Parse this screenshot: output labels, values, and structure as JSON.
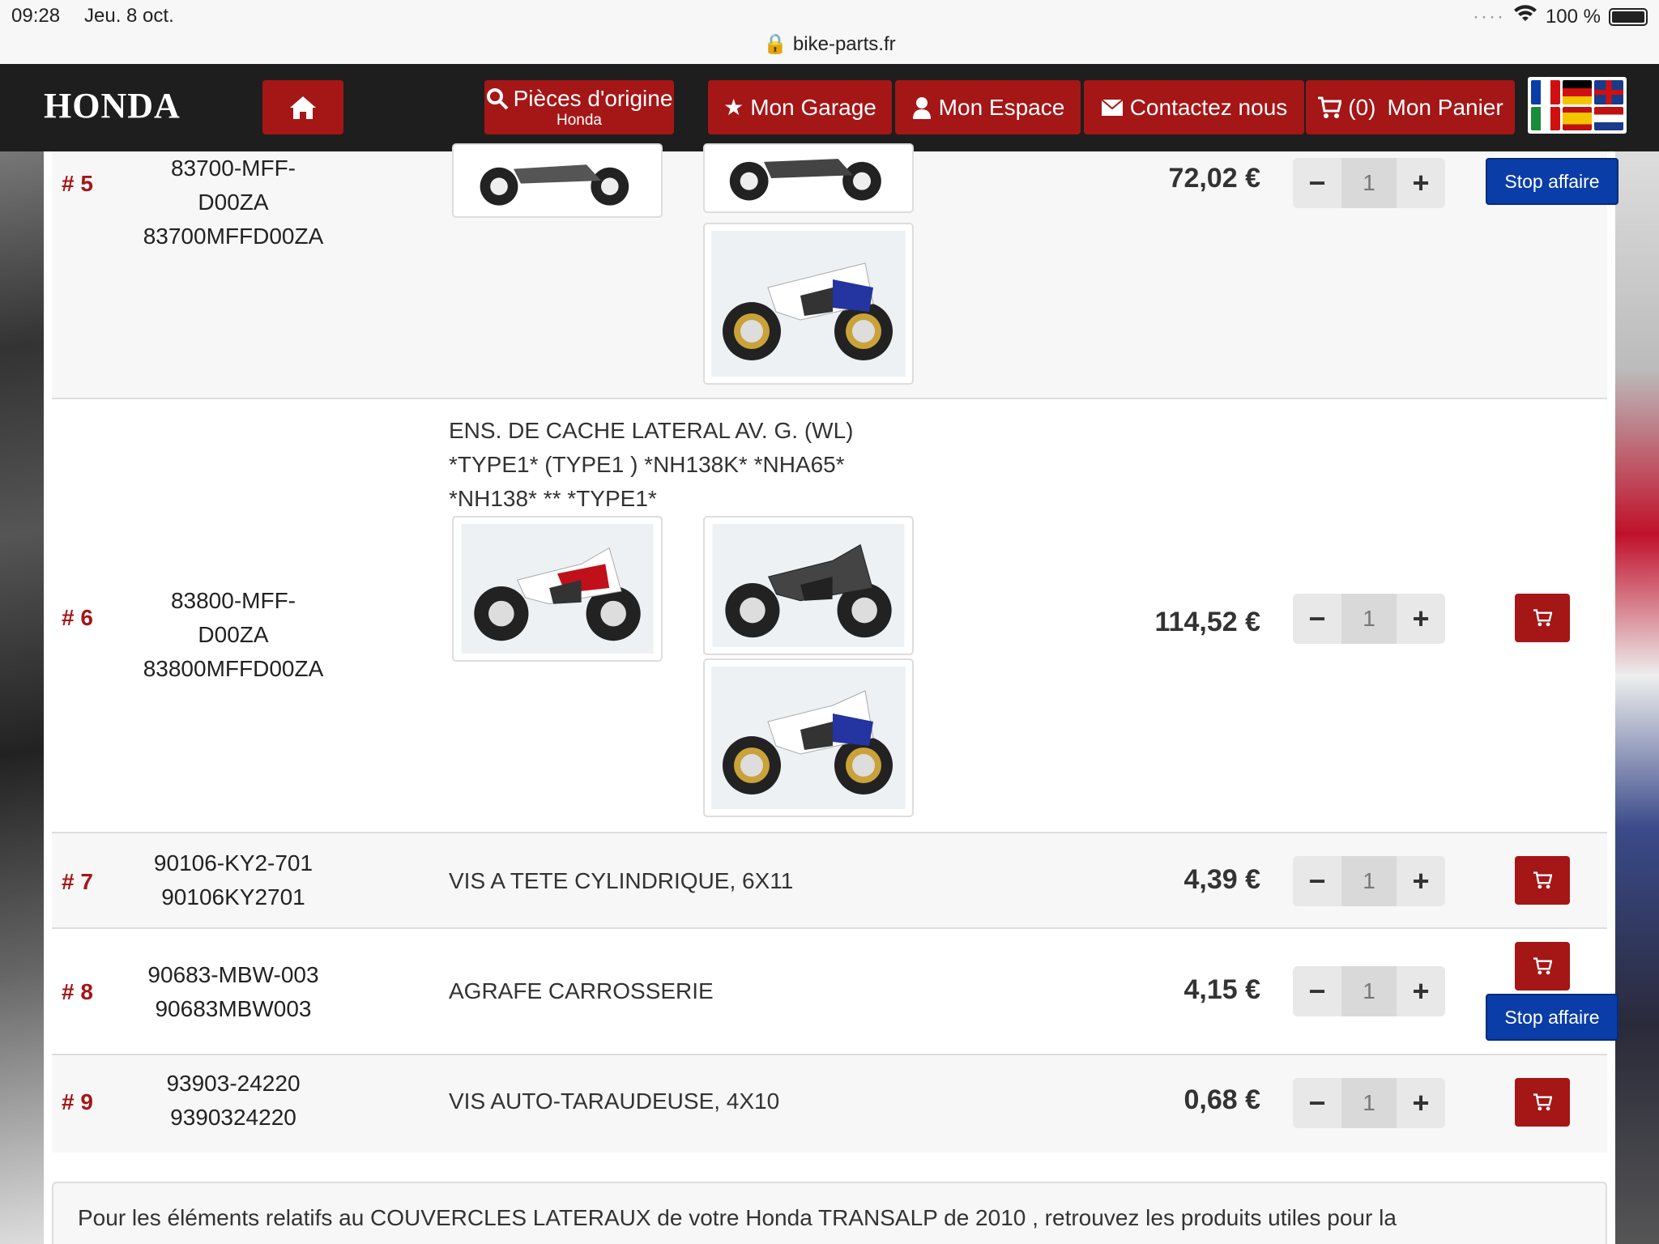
{
  "status": {
    "time": "09:28",
    "date": "Jeu. 8 oct.",
    "battery": "100 %",
    "url": "bike-parts.fr",
    "signal_icon": "dots-icon"
  },
  "nav": {
    "logo": "HONDA",
    "pieces": "Pièces d'origine",
    "pieces_sub": "Honda",
    "garage": "Mon Garage",
    "espace": "Mon Espace",
    "contact": "Contactez nous",
    "cart_count": "(0)",
    "cart": "Mon Panier"
  },
  "colors": {
    "brand_red": "#a51616",
    "stop_blue": "#0a3da8",
    "navbar": "#1e1e1e"
  },
  "stop_label": "Stop affaire",
  "rows": [
    {
      "num": "# 5",
      "ref1": "83700-MFF-D00ZA",
      "ref2": "83700MFFD00ZA",
      "desc": "",
      "price": "72,02 €",
      "qty": "1"
    },
    {
      "num": "# 6",
      "ref1": "83800-MFF-D00ZA",
      "ref2": "83800MFFD00ZA",
      "desc1": "ENS. DE CACHE LATERAL AV. G. (WL)",
      "desc2": "*TYPE1* (TYPE1 ) *NH138K* *NHA65*",
      "desc3": "*NH138* ** *TYPE1*",
      "price": "114,52 €",
      "qty": "1"
    },
    {
      "num": "# 7",
      "ref1": "90106-KY2-701",
      "ref2": "90106KY2701",
      "desc": "VIS A TETE CYLINDRIQUE, 6X11",
      "price": "4,39 €",
      "qty": "1"
    },
    {
      "num": "# 8",
      "ref1": "90683-MBW-003",
      "ref2": "90683MBW003",
      "desc": "AGRAFE CARROSSERIE",
      "price": "4,15 €",
      "qty": "1"
    },
    {
      "num": "# 9",
      "ref1": "93903-24220",
      "ref2": "9390324220",
      "desc": "VIS AUTO-TARAUDEUSE, 4X10",
      "price": "0,68 €",
      "qty": "1"
    }
  ],
  "info": "Pour les éléments relatifs au COUVERCLES LATERAUX de votre Honda TRANSALP de 2010 , retrouvez les produits utiles pour la"
}
